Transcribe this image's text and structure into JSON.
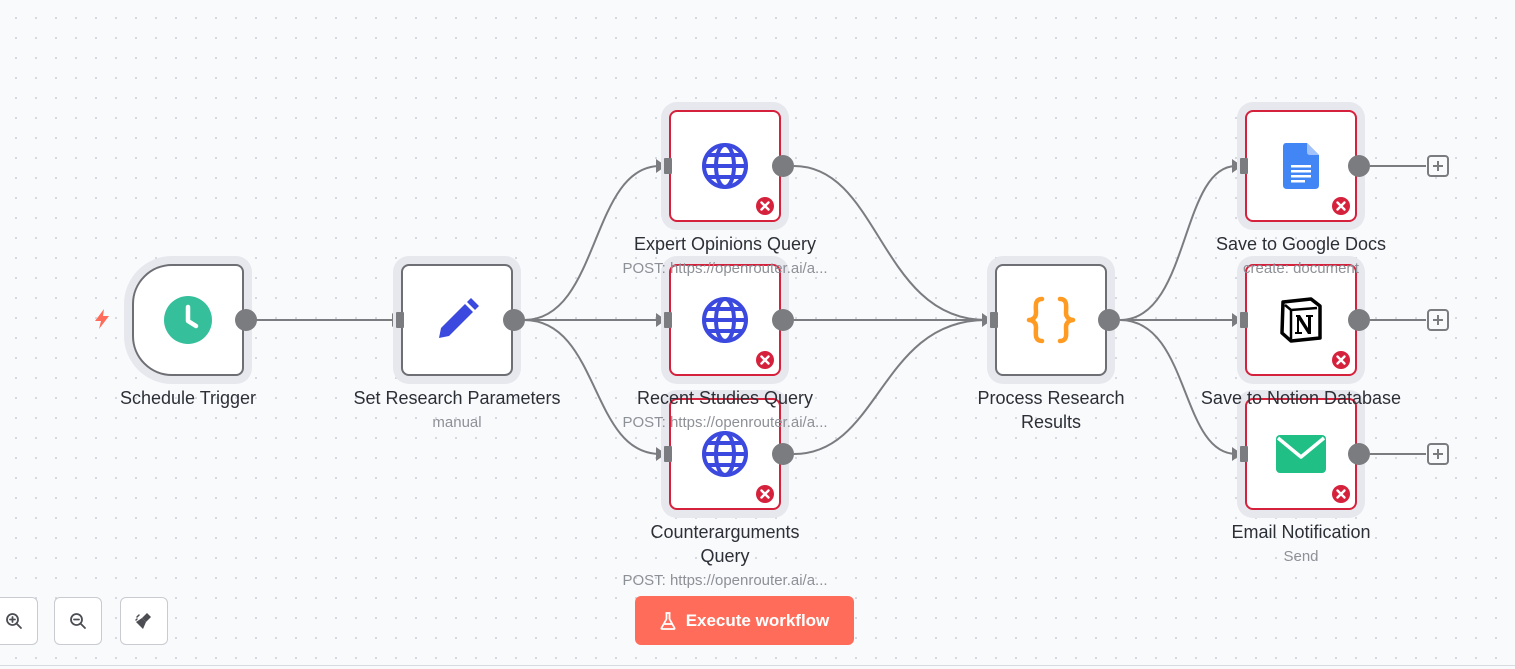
{
  "nodes": {
    "schedule_trigger": {
      "label": "Schedule Trigger",
      "subtitle": "",
      "icon": "clock-icon",
      "color": "#35c09b"
    },
    "set_params": {
      "label": "Set Research Parameters",
      "subtitle": "manual",
      "icon": "pencil-icon",
      "color": "#3b49df"
    },
    "expert_opinions": {
      "label": "Expert Opinions Query",
      "subtitle": "POST: https://openrouter.ai/a...",
      "icon": "globe-icon",
      "color": "#3b49df"
    },
    "recent_studies": {
      "label": "Recent Studies Query",
      "subtitle": "POST: https://openrouter.ai/a...",
      "icon": "globe-icon",
      "color": "#3b49df"
    },
    "counterarguments": {
      "label": "Counterarguments Query",
      "subtitle": "POST: https://openrouter.ai/a...",
      "icon": "globe-icon",
      "color": "#3b49df"
    },
    "process_results": {
      "label": "Process Research Results",
      "subtitle": "",
      "icon": "code-braces-icon",
      "color": "#ff9b22"
    },
    "google_docs": {
      "label": "Save to Google Docs",
      "subtitle": "create: document",
      "icon": "google-docs-icon",
      "color": "#4285f4"
    },
    "notion": {
      "label": "Save to Notion Database",
      "subtitle": "",
      "icon": "notion-icon",
      "color": "#000000"
    },
    "email": {
      "label": "Email Notification",
      "subtitle": "Send",
      "icon": "mail-icon",
      "color": "#1fbf86"
    }
  },
  "toolbar": {
    "execute_label": "Execute workflow",
    "zoom_in_icon": "zoom-in-icon",
    "zoom_out_icon": "zoom-out-icon",
    "tidy_icon": "broom-icon"
  },
  "colors": {
    "accent": "#ff6d5a",
    "error": "#d6213c",
    "edge": "#7b7c80"
  }
}
